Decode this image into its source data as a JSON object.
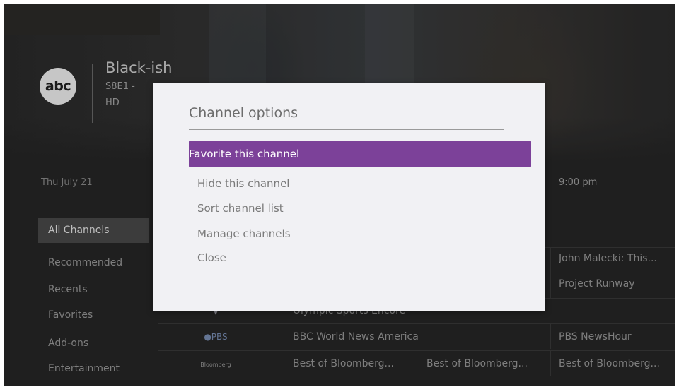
{
  "hero": {
    "network_logo": "abc",
    "show_title": "Black-ish",
    "episode": "S8E1 -",
    "quality": "HD"
  },
  "guide": {
    "date": "Thu July 21",
    "time_slot_right": "9:00 pm"
  },
  "sidebar": {
    "items": [
      {
        "label": "All Channels",
        "active": true
      },
      {
        "label": "Recommended"
      },
      {
        "label": "Recents"
      },
      {
        "label": "Favorites"
      },
      {
        "label": "Add-ons"
      },
      {
        "label": "Entertainment"
      }
    ]
  },
  "grid": {
    "rows": [
      {
        "channel": "",
        "programs": [
          "John Malecki: This..."
        ]
      },
      {
        "channel": "",
        "programs": [
          "Project Runway"
        ]
      },
      {
        "channel": "shield",
        "programs": [
          "Olympic Sports Encore"
        ]
      },
      {
        "channel": "PBS",
        "programs": [
          "BBC World News America",
          "PBS NewsHour"
        ]
      },
      {
        "channel": "Bloomberg",
        "programs": [
          "Best of Bloomberg...",
          "Best of Bloomberg...",
          "Best of Bloomberg..."
        ]
      }
    ]
  },
  "dialog": {
    "title": "Channel options",
    "options": [
      {
        "label": "Favorite this channel",
        "selected": true
      },
      {
        "label": "Hide this channel"
      },
      {
        "label": "Sort channel list"
      },
      {
        "label": "Manage channels"
      },
      {
        "label": "Close"
      }
    ]
  },
  "colors": {
    "accent": "#7c4199",
    "dialog_bg": "#f1f1f4",
    "screen_bg": "#262626"
  }
}
